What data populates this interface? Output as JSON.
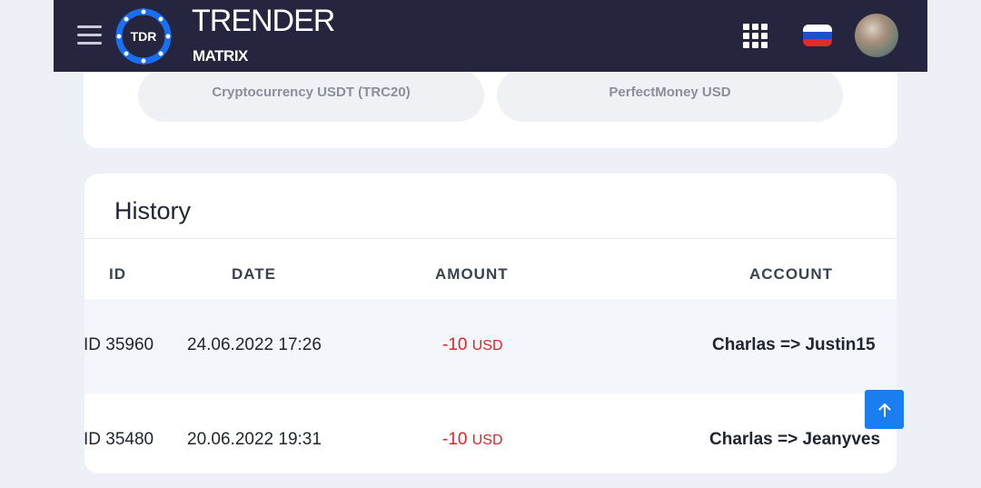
{
  "header": {
    "brand_title": "TRENDER",
    "brand_sub": "MATRIX",
    "logo_text": "TDR"
  },
  "payment_methods": [
    "Cryptocurrency USDT (TRC20)",
    "PerfectMoney USD"
  ],
  "history": {
    "title": "History",
    "columns": [
      "ID",
      "DATE",
      "AMOUNT",
      "ACCOUNT"
    ],
    "rows": [
      {
        "id": "ID 35960",
        "date": "24.06.2022 17:26",
        "amount": "-10",
        "currency": "USD",
        "account": "Charlas => Justin15"
      },
      {
        "id": "ID 35480",
        "date": "20.06.2022 19:31",
        "amount": "-10",
        "currency": "USD",
        "account": "Charlas => Jeanyves"
      }
    ]
  },
  "colors": {
    "header_bg": "#25253f",
    "accent": "#1a7ef0",
    "negative": "#e02424"
  },
  "icons": [
    "menu-icon",
    "apps-grid-icon",
    "russia-flag-icon",
    "arrow-up-icon"
  ]
}
